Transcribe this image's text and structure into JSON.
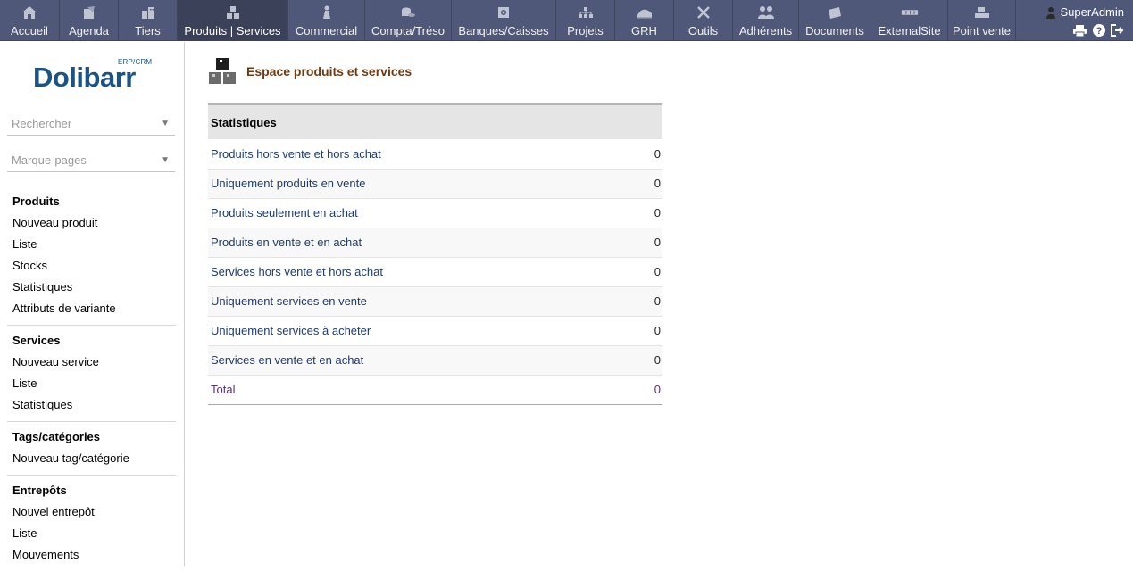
{
  "topmenu": {
    "items": [
      {
        "label": "Accueil",
        "icon": "home-icon"
      },
      {
        "label": "Agenda",
        "icon": "agenda-icon"
      },
      {
        "label": "Tiers",
        "icon": "companies-icon"
      },
      {
        "label": "Produits | Services",
        "icon": "products-icon",
        "active": true
      },
      {
        "label": "Commercial",
        "icon": "commercial-icon"
      },
      {
        "label": "Compta/Tréso",
        "icon": "accounting-icon"
      },
      {
        "label": "Banques/Caisses",
        "icon": "bank-icon"
      },
      {
        "label": "Projets",
        "icon": "projects-icon"
      },
      {
        "label": "GRH",
        "icon": "hrm-icon"
      },
      {
        "label": "Outils",
        "icon": "tools-icon"
      },
      {
        "label": "Adhérents",
        "icon": "members-icon"
      },
      {
        "label": "Documents",
        "icon": "documents-icon"
      },
      {
        "label": "ExternalSite",
        "icon": "externalsite-icon"
      },
      {
        "label": "Point vente",
        "icon": "pos-icon"
      }
    ],
    "user": {
      "name": "SuperAdmin"
    }
  },
  "sidebar": {
    "logo": {
      "brand": "Dolibarr",
      "sub": "ERP/CRM"
    },
    "search": {
      "placeholder": "Rechercher"
    },
    "bookmarks": {
      "placeholder": "Marque-pages"
    },
    "groups": [
      {
        "title": "Produits",
        "items": [
          "Nouveau produit",
          "Liste",
          "Stocks",
          "Statistiques",
          "Attributs de variante"
        ]
      },
      {
        "title": "Services",
        "items": [
          "Nouveau service",
          "Liste",
          "Statistiques"
        ]
      },
      {
        "title": "Tags/catégories",
        "items": [
          "Nouveau tag/catégorie"
        ]
      },
      {
        "title": "Entrepôts",
        "items": [
          "Nouvel entrepôt",
          "Liste",
          "Mouvements"
        ]
      }
    ]
  },
  "main": {
    "title": "Espace produits et services",
    "stats": {
      "header": "Statistiques",
      "rows": [
        {
          "label": "Produits hors vente et hors achat",
          "value": "0"
        },
        {
          "label": "Uniquement produits en vente",
          "value": "0"
        },
        {
          "label": "Produits seulement en achat",
          "value": "0"
        },
        {
          "label": "Produits en vente et en achat",
          "value": "0"
        },
        {
          "label": "Services hors vente et hors achat",
          "value": "0"
        },
        {
          "label": "Uniquement services en vente",
          "value": "0"
        },
        {
          "label": "Uniquement services à acheter",
          "value": "0"
        },
        {
          "label": "Services en vente et en achat",
          "value": "0"
        }
      ],
      "total": {
        "label": "Total",
        "value": "0"
      }
    }
  },
  "colors": {
    "topbar": "#4f5878",
    "topbar_active": "#3b4159",
    "title": "#6e3b13",
    "link": "#1d3c6f",
    "total": "#5b3276"
  }
}
